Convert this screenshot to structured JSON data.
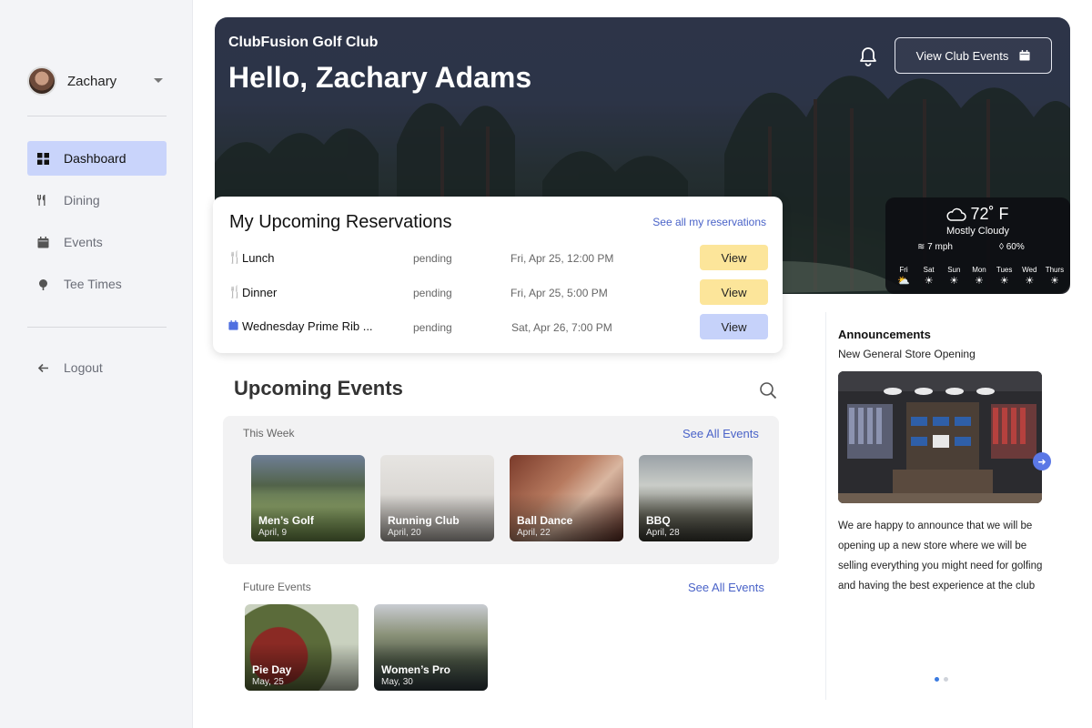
{
  "sidebar": {
    "user_name": "Zachary",
    "items": [
      {
        "label": "Dashboard"
      },
      {
        "label": "Dining"
      },
      {
        "label": "Events"
      },
      {
        "label": "Tee Times"
      },
      {
        "label": "Logout"
      }
    ]
  },
  "hero": {
    "club_name": "ClubFusion Golf Club",
    "greeting": "Hello, Zachary Adams",
    "view_events_label": "View Club Events"
  },
  "weather": {
    "temp": "72˚ F",
    "condition": "Mostly Cloudy",
    "wind": "7 mph",
    "humidity": "60%",
    "days": [
      {
        "label": "Fri",
        "icon": "partly-cloudy-icon"
      },
      {
        "label": "Sat",
        "icon": "sun-icon"
      },
      {
        "label": "Sun",
        "icon": "sun-icon"
      },
      {
        "label": "Mon",
        "icon": "sun-icon"
      },
      {
        "label": "Tues",
        "icon": "sun-icon"
      },
      {
        "label": "Wed",
        "icon": "sun-icon"
      },
      {
        "label": "Thurs",
        "icon": "sun-icon"
      }
    ]
  },
  "reservations": {
    "title": "My Upcoming Reservations",
    "see_all": "See all my reservations",
    "rows": [
      {
        "name": "Lunch",
        "icon": "dining-icon",
        "status": "pending",
        "date": "Fri, Apr 25, 12:00 PM",
        "action": "View",
        "color": "#fce59a"
      },
      {
        "name": "Dinner",
        "icon": "dining-icon",
        "status": "pending",
        "date": "Fri, Apr 25, 5:00 PM",
        "action": "View",
        "color": "#fce59a"
      },
      {
        "name": "Wednesday Prime Rib ...",
        "icon": "calendar-icon",
        "status": "pending",
        "date": "Sat, Apr 26, 7:00 PM",
        "action": "View",
        "color": "#c6d2fa"
      }
    ]
  },
  "events": {
    "title": "Upcoming Events",
    "this_week_label": "This Week",
    "future_label": "Future Events",
    "see_all": "See All Events",
    "this_week": [
      {
        "title": "Men’s Golf",
        "date": "April, 9"
      },
      {
        "title": "Running Club",
        "date": "April, 20"
      },
      {
        "title": "Ball Dance",
        "date": "April, 22"
      },
      {
        "title": "BBQ",
        "date": "April, 28"
      }
    ],
    "future": [
      {
        "title": "Pie Day",
        "date": "May, 25"
      },
      {
        "title": "Women’s Pro",
        "date": "May, 30"
      }
    ]
  },
  "announcements": {
    "title": "Announcements",
    "subtitle": "New General Store Opening",
    "body": "We are happy to announce that we will be opening up a new store where we will be selling everything you might need for golfing and having the best experience at the club"
  },
  "colors": {
    "accent": "#4a63c8",
    "active_nav": "#c9d4fb",
    "view_yellow": "#fce59a",
    "view_blue": "#c6d2fa"
  }
}
